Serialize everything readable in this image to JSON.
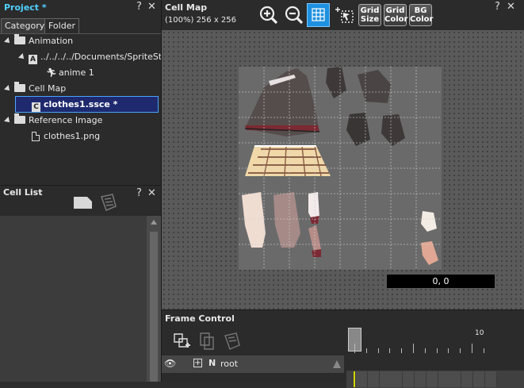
{
  "project": {
    "title": "Project *",
    "tabs": [
      "Category",
      "Folder"
    ],
    "tree": {
      "animation": "Animation",
      "ssae_path": "../../../../Documents/SpriteStudi",
      "anime": "anime 1",
      "cellmap": "Cell Map",
      "ssce": "clothes1.ssce *",
      "refimage": "Reference Image",
      "png": "clothes1.png"
    }
  },
  "cell_list": {
    "title": "Cell List"
  },
  "cell_map": {
    "title": "Cell Map",
    "info": "(100%) 256 x 256",
    "grid_size": [
      "Grid",
      "Size"
    ],
    "grid_color": [
      "Grid",
      "Color"
    ],
    "bg_color": [
      "BG",
      "Color"
    ],
    "coord": "0, 0"
  },
  "frame_control": {
    "title": "Frame Control",
    "layer_flag": "N",
    "layer_name": "root",
    "frame_label": "10"
  },
  "window_controls": {
    "help": "?",
    "close": "✕"
  }
}
